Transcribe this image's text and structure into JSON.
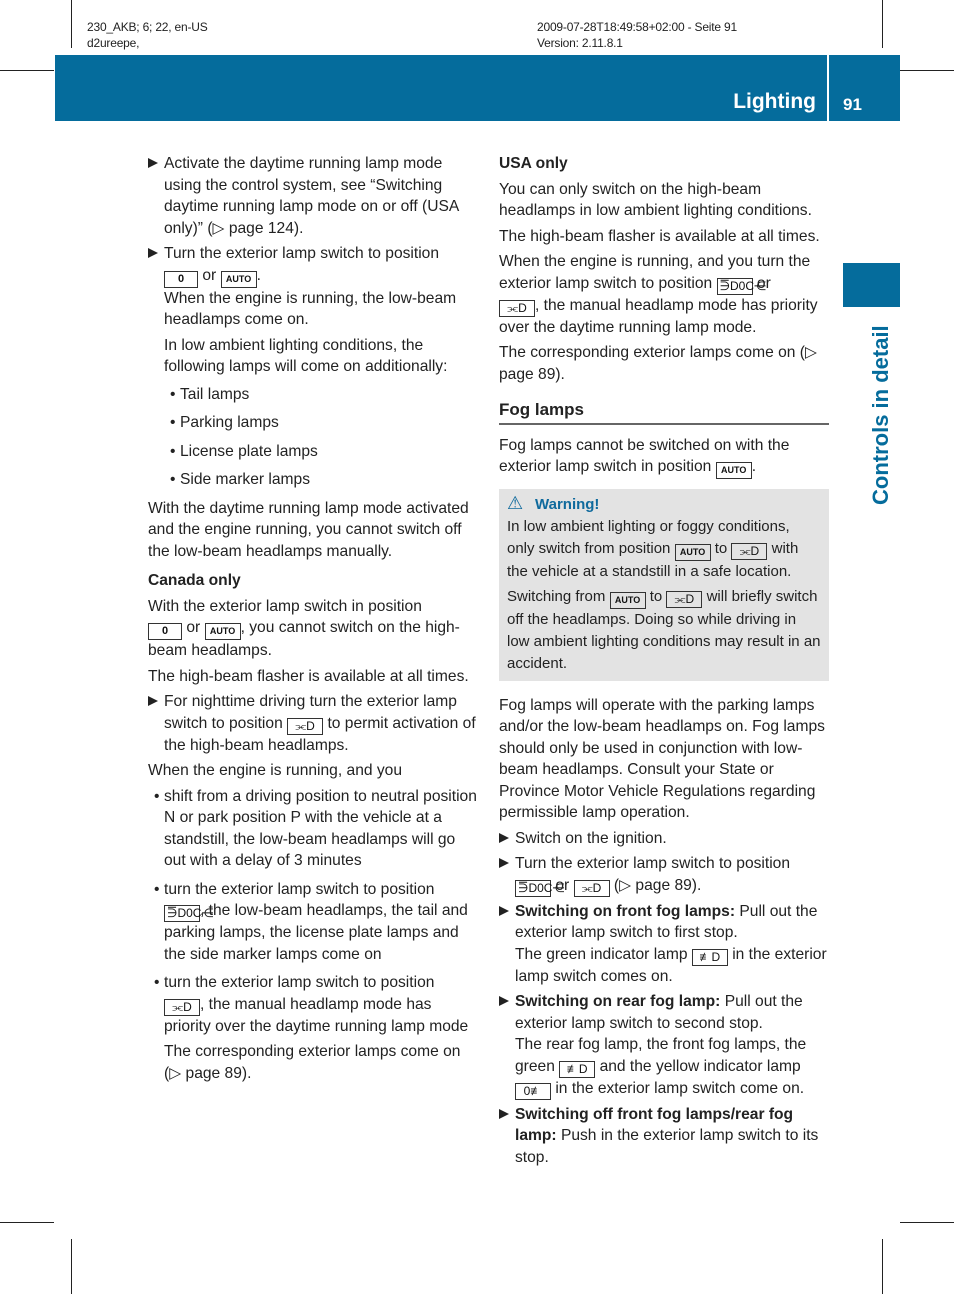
{
  "meta": {
    "line1_left": "230_AKB; 6; 22, en-US",
    "line2_left": "d2ureepe,",
    "line1_right": "2009-07-28T18:49:58+02:00 - Seite 91",
    "line2_right": "Version: 2.11.8.1"
  },
  "header": {
    "title": "Lighting",
    "page": "91",
    "color": "#056c9c"
  },
  "side_tab": {
    "label": "Controls in detail"
  },
  "symbols": {
    "zero": "0",
    "auto": "AUTO",
    "low_beam": "⫘D",
    "park": "⋽D0C⋲",
    "front_fog": "≢D",
    "rear_fog": "0≢"
  },
  "left": {
    "step1": "Activate the daytime running lamp mode using the control system, see “Switching daytime running lamp mode on or off (USA only)” (▷ page 124).",
    "step2_a": "Turn the exterior lamp switch to position",
    "or": "or",
    "step2_sub1": "When the engine is running, the low-beam headlamps come on.",
    "step2_sub2": "In low ambient lighting conditions, the following lamps will come on additionally:",
    "lamps": [
      "Tail lamps",
      "Parking lamps",
      "License plate lamps",
      "Side marker lamps"
    ],
    "para1": "With the daytime running lamp mode activated and the engine running, you cannot switch off the low-beam headlamps manually.",
    "canada_heading": "Canada only",
    "canada_p1_a": "With the exterior lamp switch in position",
    "canada_p1_b": ", you cannot switch on the high-beam headlamps.",
    "canada_p2": "The high-beam flasher is available at all times.",
    "canada_step_a": "For nighttime driving turn the exterior lamp switch to position",
    "canada_step_b": "to permit activation of the high-beam headlamps.",
    "engine_p": "When the engine is running, and you",
    "b1": "shift from a driving position to neutral position N or park position P with the vehicle at a standstill, the low-beam headlamps will go out with a delay of 3 minutes",
    "b2_a": "turn the exterior lamp switch to position",
    "b2_b": ", the low-beam headlamps, the tail and parking lamps, the license plate lamps and the side marker lamps come on",
    "b3_a": "turn the exterior lamp switch to position",
    "b3_b": ", the manual headlamp mode has priority over the daytime running lamp mode",
    "b3_sub": "The corresponding exterior lamps come on (▷ page 89)."
  },
  "right": {
    "usa_heading": "USA only",
    "usa_p1": "You can only switch on the high-beam headlamps in low ambient lighting conditions.",
    "usa_p2": "The high-beam flasher is available at all times.",
    "usa_p3_a": "When the engine is running, and you turn the exterior lamp switch to position",
    "usa_p3_b": ", the manual headlamp mode has priority over the daytime running lamp mode.",
    "usa_p4": "The corresponding exterior lamps come on (▷ page 89).",
    "fog_heading": "Fog lamps",
    "fog_p1": "Fog lamps cannot be switched on with the exterior lamp switch in position",
    "warning_title": "Warning!",
    "warn_p1_a": "In low ambient lighting or foggy conditions, only switch from position",
    "to": "to",
    "warn_p1_b": "with the vehicle at a standstill in a safe location.",
    "warn_p2_a": "Switching from",
    "warn_p2_b": "will briefly switch off the headlamps. Doing so while driving in low ambient lighting conditions may result in an accident.",
    "fog_p2": "Fog lamps will operate with the parking lamps and/or the low-beam headlamps on. Fog lamps should only be used in conjunction with low-beam headlamps. Consult your State or Province Motor Vehicle Regulations regarding permissible lamp operation.",
    "s1": "Switch on the ignition.",
    "s2_a": "Turn the exterior lamp switch to position",
    "s2_b": "(▷ page 89).",
    "s3_bold": "Switching on front fog lamps:",
    "s3_rest": "Pull out the exterior lamp switch to first stop.",
    "s3_sub_a": "The green indicator lamp",
    "s3_sub_b": "in the exterior lamp switch comes on.",
    "s4_bold": "Switching on rear fog lamp:",
    "s4_rest": "Pull out the exterior lamp switch to second stop.",
    "s4_sub_a": "The rear fog lamp, the front fog lamps, the green",
    "s4_sub_b": "and the yellow indicator lamp",
    "s4_sub_c": "in the exterior lamp switch come on.",
    "s5_bold": "Switching off front fog lamps/rear fog lamp:",
    "s5_rest": "Push in the exterior lamp switch to its stop."
  }
}
